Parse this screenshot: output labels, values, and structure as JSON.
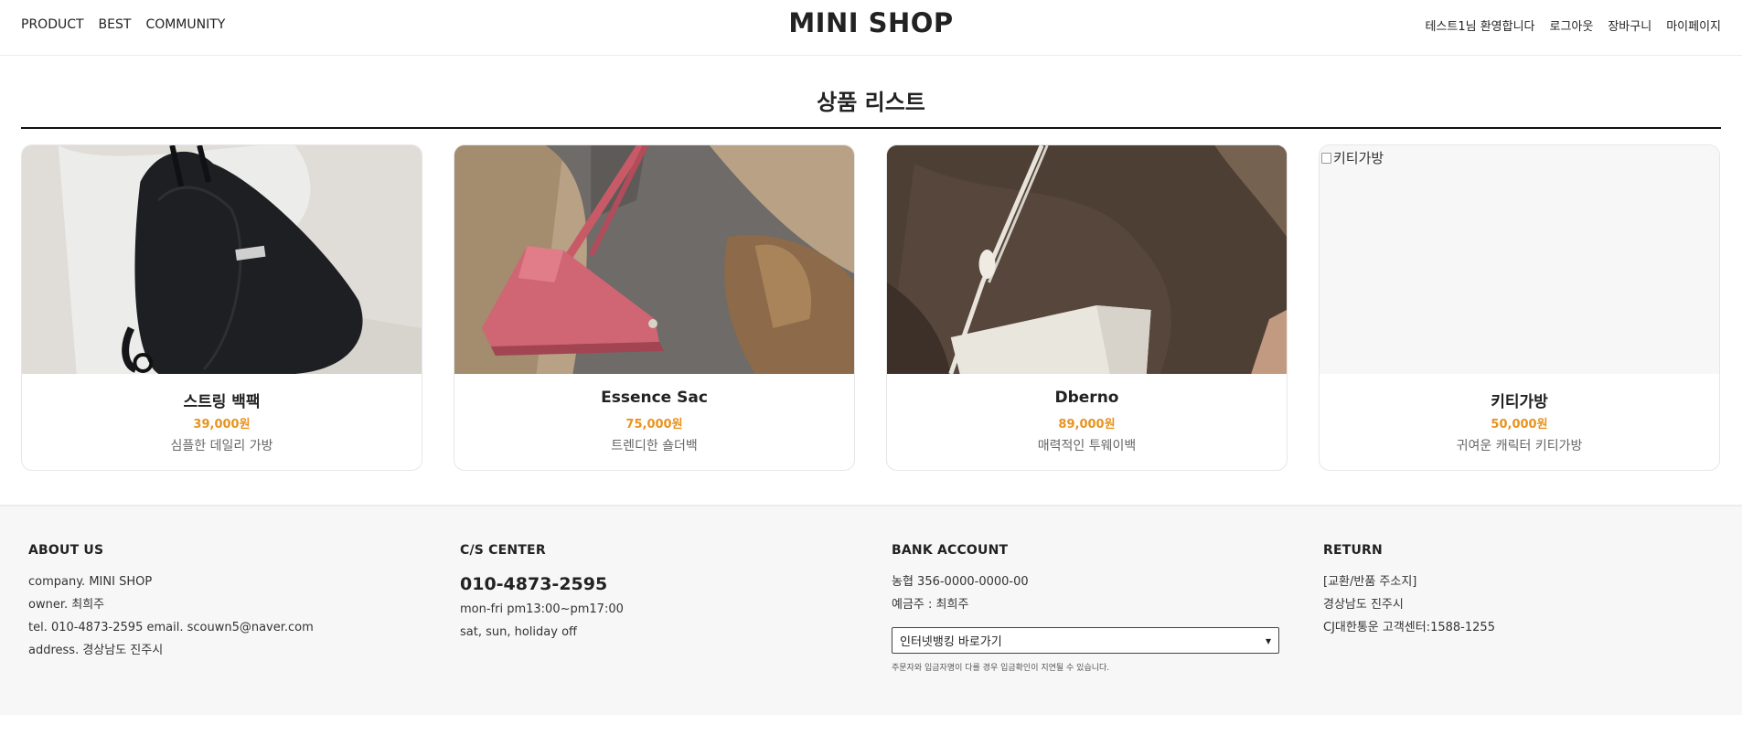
{
  "header": {
    "nav_left": [
      "PRODUCT",
      "BEST",
      "COMMUNITY"
    ],
    "logo": "MINI SHOP",
    "welcome": "테스트1님 환영합니다",
    "logout": "로그아웃",
    "cart": "장바구니",
    "mypage": "마이페이지"
  },
  "main": {
    "title": "상품 리스트",
    "products": [
      {
        "name": "스트링 백팩",
        "price": "39,000원",
        "desc": "심플한 데일리 가방"
      },
      {
        "name": "Essence Sac",
        "price": "75,000원",
        "desc": "트렌디한 숄더백"
      },
      {
        "name": "Dberno",
        "price": "89,000원",
        "desc": "매력적인 투웨이백"
      },
      {
        "name": "키티가방",
        "price": "50,000원",
        "desc": "귀여운 캐릭터 키티가방",
        "image_alt": "키티가방"
      }
    ]
  },
  "footer": {
    "about": {
      "title": "ABOUT US",
      "company": "company. MINI SHOP",
      "owner": "owner. 최희주",
      "tel": "tel. 010-4873-2595 email. scouwn5@naver.com",
      "address": "address. 경상남도 진주시"
    },
    "cs": {
      "title": "C/S CENTER",
      "phone": "010-4873-2595",
      "hours": "mon-fri pm13:00~pm17:00",
      "off": "sat, sun, holiday off"
    },
    "bank": {
      "title": "BANK ACCOUNT",
      "account": "농협 356-0000-0000-00",
      "holder": "예금주 : 최희주",
      "select_value": "인터넷뱅킹 바로가기",
      "note": "주문자와 입금자명이 다를 경우 입금확인이 지연될 수 있습니다."
    },
    "return": {
      "title": "RETURN",
      "line1": "[교환/반품 주소지]",
      "line2": "경상남도 진주시",
      "line3": "CJ대한통운 고객센터:1588-1255"
    }
  }
}
